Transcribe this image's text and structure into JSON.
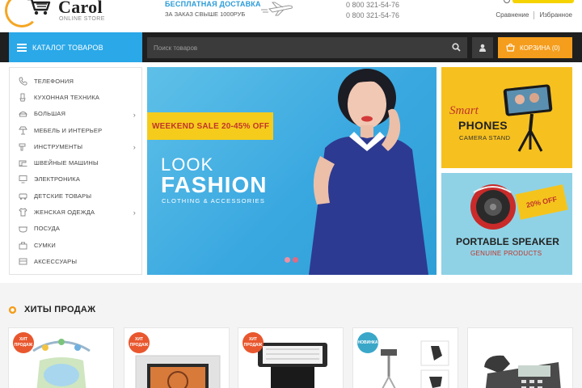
{
  "header": {
    "logo_name": "Carol",
    "logo_sub": "ONLINE STORE",
    "delivery_title": "БЕСПЛАТНАЯ ДОСТАВКА",
    "delivery_sub": "ЗА ЗАКАЗ СВЫШЕ 1000РУБ",
    "phones": [
      "0 800 321-54-76",
      "0 800 321-54-76"
    ],
    "compare_label": "Сравнение",
    "favorites_label": "Избранное"
  },
  "nav": {
    "catalog_label": "КАТАЛОГ ТОВАРОВ",
    "search_placeholder": "Поиск товаров",
    "cart_label": "КОРЗИНА (0)"
  },
  "sidebar": {
    "items": [
      {
        "label": "ТЕЛЕФОНИЯ",
        "icon": "phone-icon",
        "has_submenu": false
      },
      {
        "label": "КУХОННАЯ ТЕХНИКА",
        "icon": "kitchen-icon",
        "has_submenu": false
      },
      {
        "label": "БОЛЬШАЯ",
        "icon": "appliance-icon",
        "has_submenu": true
      },
      {
        "label": "МЕБЕЛЬ И ИНТЕРЬЕР",
        "icon": "furniture-icon",
        "has_submenu": false
      },
      {
        "label": "ИНСТРУМЕНТЫ",
        "icon": "tools-icon",
        "has_submenu": true
      },
      {
        "label": "ШВЕЙНЫЕ МАШИНЫ",
        "icon": "sewing-machine-icon",
        "has_submenu": false
      },
      {
        "label": "ЭЛЕКТРОНИКА",
        "icon": "monitor-icon",
        "has_submenu": false
      },
      {
        "label": "ДЕТСКИЕ ТОВАРЫ",
        "icon": "kids-icon",
        "has_submenu": false
      },
      {
        "label": "ЖЕНСКАЯ ОДЕЖДА",
        "icon": "dress-icon",
        "has_submenu": true
      },
      {
        "label": "ПОСУДА",
        "icon": "dishes-icon",
        "has_submenu": false
      },
      {
        "label": "СУМКИ",
        "icon": "bag-icon",
        "has_submenu": false
      },
      {
        "label": "АКСЕССУАРЫ",
        "icon": "accessories-icon",
        "has_submenu": false
      }
    ]
  },
  "banner": {
    "sale": "WEEKEND SALE 20-45% OFF",
    "look": "LOOK",
    "fashion": "FASHION",
    "sub": "CLOTHING & ACCESSORIES",
    "slide_count": 2,
    "active_slide": 2
  },
  "promo_phones": {
    "smart": "Smart",
    "phones": "PHONES",
    "sub": "CAMERA STAND"
  },
  "promo_speaker": {
    "discount": "20% OFF",
    "title": "PORTABLE SPEAKER",
    "sub": "GENUINE PRODUCTS"
  },
  "hits": {
    "title": "ХИТЫ ПРОДАЖ",
    "products": [
      {
        "badge": [
          "ХИТ",
          "ПРОДАЖ"
        ],
        "badge_type": "hit",
        "image": "baby-bouncer"
      },
      {
        "badge": [
          "ХИТ",
          "ПРОДАЖ"
        ],
        "badge_type": "hit",
        "image": "photo-frame"
      },
      {
        "badge": [
          "ХИТ",
          "ПРОДАЖ"
        ],
        "badge_type": "hit",
        "image": "camera-flash"
      },
      {
        "badge": [
          "НОВИНКА"
        ],
        "badge_type": "new",
        "image": "tripod"
      },
      {
        "badge": [],
        "badge_type": "",
        "image": "office-phone"
      }
    ]
  },
  "colors": {
    "accent_blue": "#2aa8e8",
    "cart_orange": "#f59d1c",
    "navbar": "#1f1f1f",
    "sale_yellow": "#f5cc1b",
    "hit_badge": "#e9572e",
    "new_badge": "#3aa7c9"
  }
}
